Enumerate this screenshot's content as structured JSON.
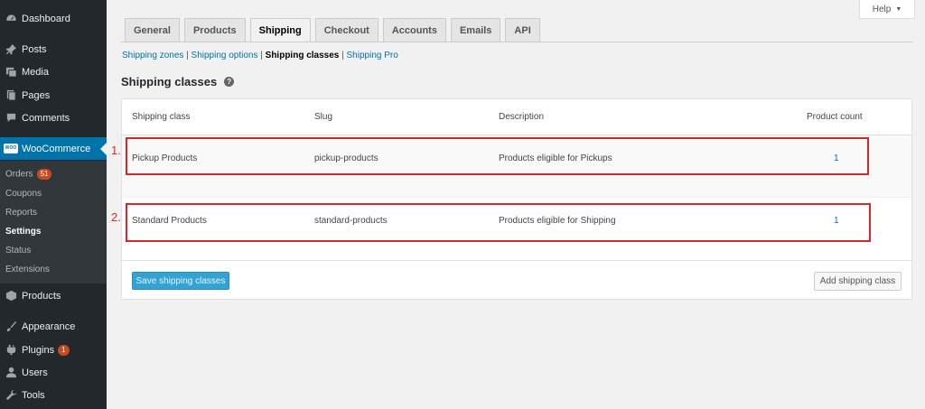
{
  "sidebar": {
    "items": [
      {
        "label": "Dashboard",
        "icon": "dashboard-icon"
      },
      {
        "label": "Posts",
        "icon": "pin-icon"
      },
      {
        "label": "Media",
        "icon": "media-icon"
      },
      {
        "label": "Pages",
        "icon": "pages-icon"
      },
      {
        "label": "Comments",
        "icon": "comments-icon"
      },
      {
        "label": "WooCommerce",
        "icon": "woo-icon"
      },
      {
        "label": "Products",
        "icon": "box-icon"
      },
      {
        "label": "Appearance",
        "icon": "brush-icon"
      },
      {
        "label": "Plugins",
        "icon": "plugin-icon",
        "badge": "1"
      },
      {
        "label": "Users",
        "icon": "user-icon"
      },
      {
        "label": "Tools",
        "icon": "wrench-icon"
      }
    ],
    "woo_icon_text": "WOO",
    "submenu": [
      {
        "label": "Orders",
        "badge": "51"
      },
      {
        "label": "Coupons"
      },
      {
        "label": "Reports"
      },
      {
        "label": "Settings"
      },
      {
        "label": "Status"
      },
      {
        "label": "Extensions"
      }
    ]
  },
  "help": {
    "label": "Help",
    "arrow": "▼"
  },
  "tabs": [
    "General",
    "Products",
    "Shipping",
    "Checkout",
    "Accounts",
    "Emails",
    "API"
  ],
  "sublinks": {
    "zones": "Shipping zones",
    "options": "Shipping options",
    "classes": "Shipping classes",
    "pro": "Shipping Pro",
    "sep": " | "
  },
  "heading": {
    "title": "Shipping classes",
    "help_glyph": "?"
  },
  "table": {
    "columns": [
      "Shipping class",
      "Slug",
      "Description",
      "Product count"
    ],
    "rows": [
      {
        "name": "Pickup Products",
        "slug": "pickup-products",
        "description": "Products eligible for Pickups",
        "count": "1"
      },
      {
        "name": "Standard Products",
        "slug": "standard-products",
        "description": "Products eligible for Shipping",
        "count": "1"
      }
    ],
    "save_label": "Save shipping classes",
    "add_label": "Add shipping class"
  },
  "annotations": [
    "1.",
    "2."
  ],
  "colors": {
    "sidebar": "#23282d",
    "accent": "#0073aa",
    "annotation": "#d9262b"
  }
}
